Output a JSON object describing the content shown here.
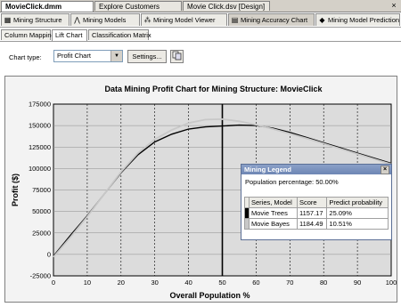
{
  "doc_tabs": [
    "MovieClick.dmm [Design]",
    "Explore Customers Table",
    "Movie Click.dsv [Design]"
  ],
  "close_glyph": "×",
  "designer_tabs": [
    "Mining Structure",
    "Mining Models",
    "Mining Model Viewer",
    "Mining Accuracy Chart",
    "Mining Model Prediction"
  ],
  "sub_tabs": [
    "Column Mapping",
    "Lift Chart",
    "Classification Matrix"
  ],
  "toolbar": {
    "chart_type_label": "Chart type:",
    "chart_type_value": "Profit Chart",
    "settings_label": "Settings..."
  },
  "chart_data": {
    "type": "line",
    "title": "Data Mining Profit Chart for Mining Structure: MovieClick",
    "xlabel": "Overall Population %",
    "ylabel": "Profit ($)",
    "xlim": [
      0,
      100
    ],
    "ylim": [
      -25000,
      175000
    ],
    "x_ticks": [
      "0",
      "10",
      "20",
      "30",
      "40",
      "50",
      "60",
      "70",
      "80",
      "90",
      "100"
    ],
    "y_ticks": [
      "-25000",
      "0",
      "25000",
      "50000",
      "75000",
      "100000",
      "125000",
      "150000",
      "175000"
    ],
    "grid": true,
    "cursor_x": 50,
    "series": [
      {
        "name": "Movie Trees",
        "color": "#000000",
        "x": [
          0,
          5,
          10,
          15,
          20,
          25,
          30,
          35,
          40,
          45,
          50,
          55,
          60,
          65,
          70,
          75,
          80,
          85,
          90,
          95,
          100
        ],
        "y": [
          -2000,
          22000,
          45000,
          70000,
          95000,
          116000,
          131000,
          140000,
          146000,
          148500,
          149500,
          150500,
          150000,
          147000,
          142000,
          136000,
          130000,
          124000,
          118000,
          112000,
          106000
        ]
      },
      {
        "name": "Movie Bayes",
        "color": "#c8c8c8",
        "x": [
          0,
          5,
          10,
          15,
          20,
          25,
          30,
          35,
          40,
          45,
          50,
          55,
          60,
          65,
          70,
          75,
          80,
          85,
          90,
          95,
          100
        ],
        "y": [
          -3000,
          20000,
          44000,
          70000,
          96000,
          118000,
          134000,
          145000,
          153000,
          157000,
          157500,
          155000,
          151000,
          146000,
          140500,
          135000,
          129000,
          123000,
          117000,
          111000,
          105000
        ]
      }
    ]
  },
  "legend": {
    "title": "Mining Legend",
    "population_label": "Population percentage: 50.00%",
    "columns": [
      "Series, Model",
      "Score",
      "Predict probability"
    ],
    "rows": [
      {
        "model": "Movie Trees",
        "score": "1157.17",
        "probability": "25.09%",
        "color": "#000000"
      },
      {
        "model": "Movie Bayes",
        "score": "1184.49",
        "probability": "10.51%",
        "color": "#c8c8c8"
      }
    ]
  }
}
